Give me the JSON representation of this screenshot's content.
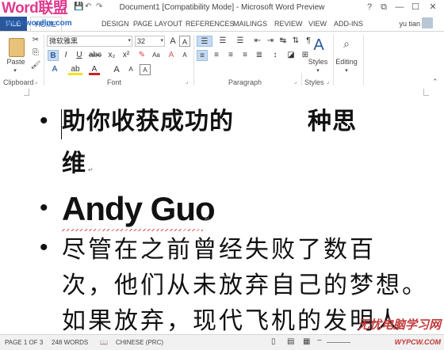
{
  "watermark_logo": "Word联盟",
  "watermark_url": "www.wordlm.com",
  "window": {
    "title": "Document1 [Compatibility Mode] - Microsoft Word Preview",
    "help": "?",
    "restore": "⧉",
    "minimize": "—",
    "maximize": "☐",
    "close": "✕"
  },
  "tabs": {
    "file": "FILE",
    "home": "HOME",
    "items": [
      "DESIGN",
      "PAGE LAYOUT",
      "REFERENCES",
      "MAILINGS",
      "REVIEW",
      "VIEW",
      "ADD-INS"
    ]
  },
  "user": "yu tian",
  "ribbon": {
    "clipboard": {
      "label": "Clipboard",
      "paste": "Paste"
    },
    "font": {
      "label": "Font",
      "font_name": "微软雅黑",
      "font_size": "32",
      "bold": "B",
      "italic": "I",
      "underline": "U",
      "strike": "abc",
      "subscript": "x₂",
      "superscript": "x²",
      "grow": "A",
      "shrink": "A",
      "change_case": "Aa",
      "clear": "A",
      "highlight": "ab",
      "color": "A",
      "effects": "A",
      "char_border": "A"
    },
    "paragraph": {
      "label": "Paragraph"
    },
    "styles": {
      "label": "Styles",
      "button": "Styles"
    },
    "editing": {
      "button": "Editing"
    }
  },
  "document": {
    "para1_line1": "助你收获成功的　　　种思",
    "para1_line2": "维",
    "para2": "Andy Guo",
    "para3_lines": [
      "尽管在之前曾经失败了数百",
      "次，他们从未放弃自己的梦想。",
      "如果放弃，现代飞机的发明人"
    ],
    "bullet": "•",
    "pilcrow": "↵"
  },
  "status": {
    "page": "PAGE 1 OF 3",
    "words": "248 WORDS",
    "language": "CHINESE (PRC)",
    "zoom_minus": "−"
  },
  "watermark_bottom": "无忧电脑学习网",
  "watermark_bottom_url": "WYPCW.COM",
  "colors": {
    "file_tab": "#2b579a",
    "accent": "#2b579a",
    "logo": "#e0398f"
  }
}
